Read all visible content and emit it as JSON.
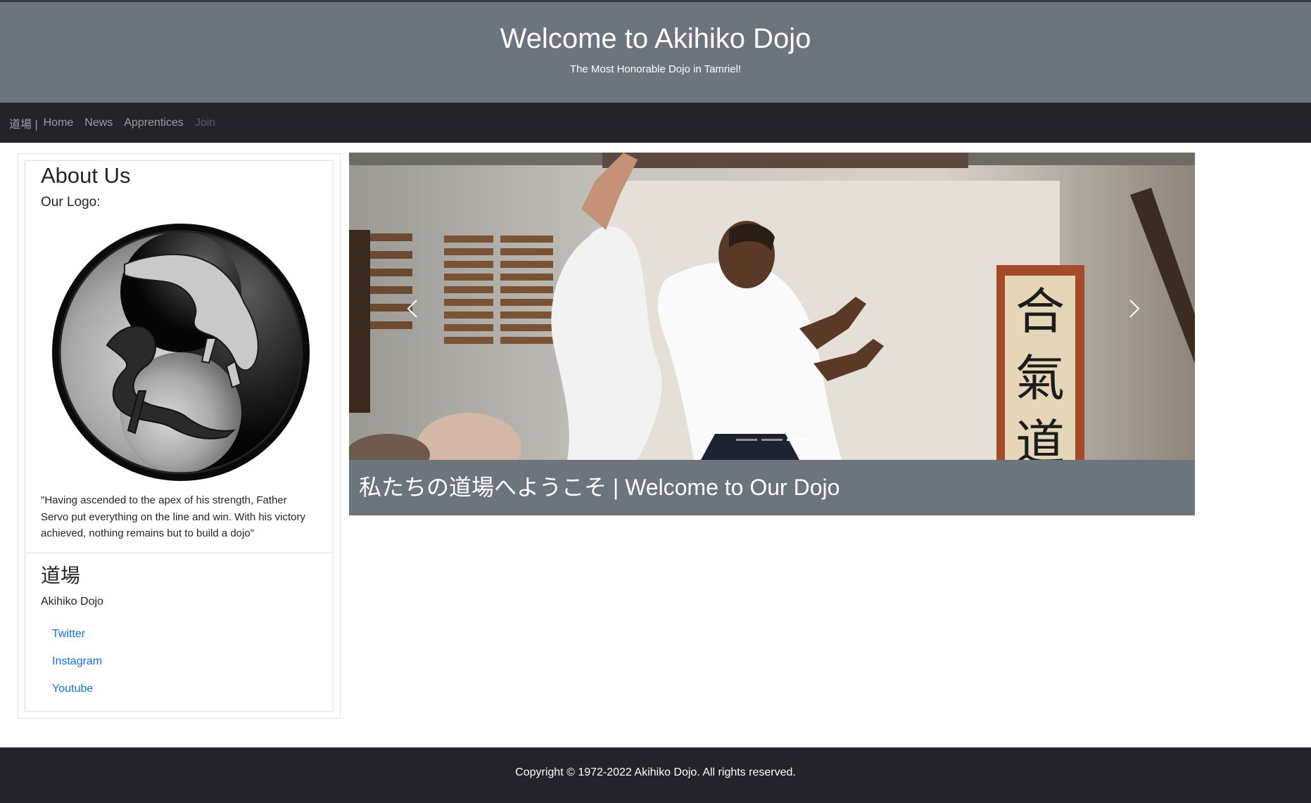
{
  "header": {
    "title": "Welcome to Akihiko Dojo",
    "subtitle": "The Most Honorable Dojo in Tamriel!"
  },
  "navbar": {
    "brand": "道場 |",
    "links": [
      "Home",
      "News",
      "Apprentices",
      "Join"
    ],
    "disabled_link": "Join"
  },
  "sidebar": {
    "heading": "About Us",
    "logo_label": "Our Logo:",
    "logo_icon": "yin-yang-tiger-dragon-logo",
    "quote": "\"Having ascended to the apex of his strength, Father Servo put everything on the line and win. With his victory achieved, nothing remains but to build a dojo\"",
    "dojo_heading": "道場",
    "dojo_name": "Akihiko Dojo",
    "social_links": [
      "Twitter",
      "Instagram",
      "Youtube"
    ]
  },
  "carousel": {
    "caption": "私たちの道場へようこそ | Welcome to Our Dojo",
    "prev_icon": "chevron-left-icon",
    "next_icon": "chevron-right-icon",
    "indicator_count": 3,
    "active_indicator": 3
  },
  "footer": {
    "copyright": "Copyright © 1972-2022 Akihiko Dojo. All rights reserved."
  },
  "colors": {
    "header_bg": "#6c757d",
    "navbar_bg": "#212529",
    "link": "#0d6efd",
    "footer_bg": "#212529"
  }
}
